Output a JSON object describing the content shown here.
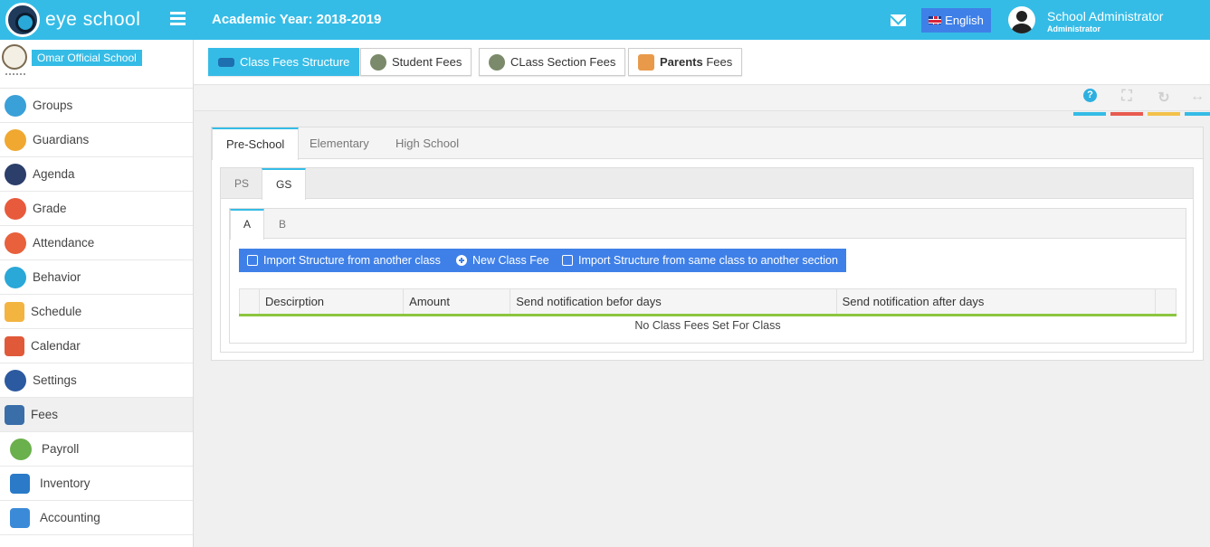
{
  "header": {
    "brand": "eye school",
    "academic_year": "Academic Year: 2018-2019",
    "language_label": "English",
    "user_name": "School Administrator",
    "user_role": "Administrator",
    "accent_color": "#35bce6"
  },
  "sidebar": {
    "school_name": "Omar Official School",
    "items": [
      {
        "label": "Groups",
        "icon": "groups-icon",
        "color": "#3aa0d8"
      },
      {
        "label": "Guardians",
        "icon": "guardians-icon",
        "color": "#f0a830"
      },
      {
        "label": "Agenda",
        "icon": "agenda-icon",
        "color": "#2c3e6a"
      },
      {
        "label": "Grade",
        "icon": "grade-icon",
        "color": "#e85a3c"
      },
      {
        "label": "Attendance",
        "icon": "attendance-icon",
        "color": "#e8603c"
      },
      {
        "label": "Behavior",
        "icon": "behavior-icon",
        "color": "#2aa8d8"
      },
      {
        "label": "Schedule",
        "icon": "schedule-icon",
        "color": "#f3b440"
      },
      {
        "label": "Calendar",
        "icon": "calendar-icon",
        "color": "#e05a3a"
      },
      {
        "label": "Settings",
        "icon": "settings-icon",
        "color": "#2c5aa0"
      },
      {
        "label": "Fees",
        "icon": "fees-icon",
        "color": "#3a6ea8"
      },
      {
        "label": "Payroll",
        "icon": "payroll-icon",
        "color": "#6ab04c"
      },
      {
        "label": "Inventory",
        "icon": "inventory-icon",
        "color": "#2a7ac8"
      },
      {
        "label": "Accounting",
        "icon": "accounting-icon",
        "color": "#3a8ad8"
      }
    ]
  },
  "toolbar": {
    "buttons": [
      {
        "label": "Class Fees Structure"
      },
      {
        "label": "Student Fees"
      },
      {
        "label": "CLass Section Fees"
      },
      {
        "label_bold": "Parents",
        "label": " Fees"
      }
    ],
    "controls": {
      "help": "?",
      "colors": [
        "#35bce6",
        "#e85a4f",
        "#f3c14a",
        "#35bce6"
      ]
    }
  },
  "content": {
    "level_tabs": [
      "Pre-School",
      "Elementary",
      "High School"
    ],
    "grade_tabs": [
      "PS",
      "GS"
    ],
    "section_tabs": [
      "A",
      "B"
    ],
    "actions": [
      "Import Structure from another class",
      "New Class Fee",
      "Import Structure from same class to another section"
    ],
    "table": {
      "columns": [
        "Descirption",
        "Amount",
        "Send notification befor days",
        "Send notification after days"
      ],
      "empty_message": "No Class Fees Set For Class"
    }
  }
}
